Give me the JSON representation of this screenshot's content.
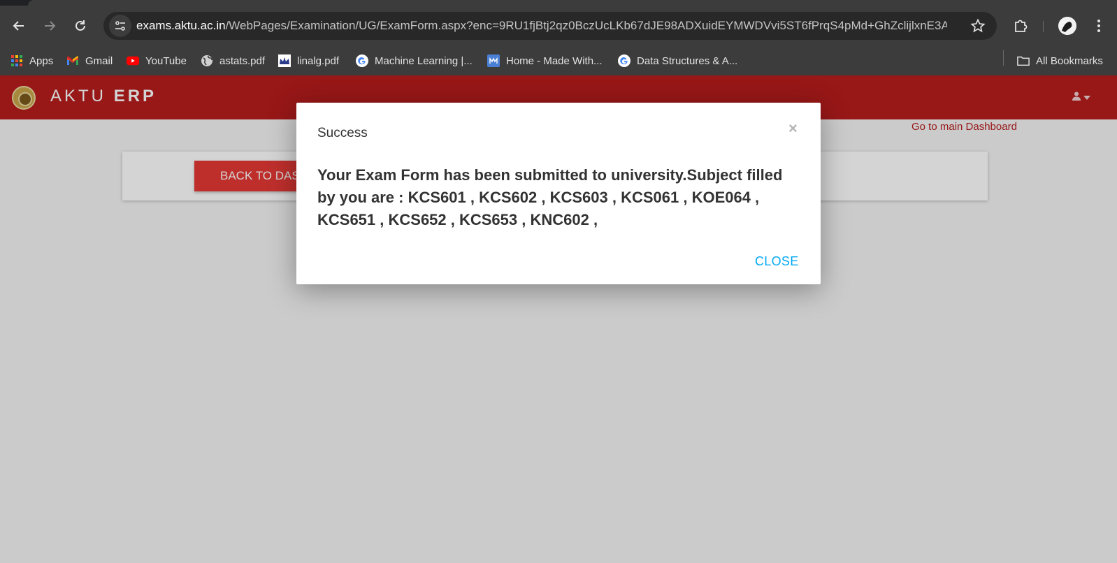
{
  "browser": {
    "url_host": "exams.aktu.ac.in",
    "url_path": "/WebPages/Examination/UG/ExamForm.aspx?enc=9RU1fjBtj2qz0BczUcLKb67dJE98ADXuidEYMWDVvi5ST6fPrqS4pMd+GhZclijlxnE3AX7...",
    "bookmarks": [
      {
        "label": "Apps",
        "icon": "apps-grid-icon"
      },
      {
        "label": "Gmail",
        "icon": "gmail-icon"
      },
      {
        "label": "YouTube",
        "icon": "youtube-icon"
      },
      {
        "label": "astats.pdf",
        "icon": "globe-icon"
      },
      {
        "label": "linalg.pdf",
        "icon": "crown-icon"
      },
      {
        "label": "Machine Learning  |...",
        "icon": "google-icon"
      },
      {
        "label": "Home - Made With...",
        "icon": "madewith-icon"
      },
      {
        "label": "Data Structures & A...",
        "icon": "google-icon"
      }
    ],
    "all_bookmarks_label": "All Bookmarks"
  },
  "header": {
    "brand_light": "AKTU",
    "brand_bold": "ERP",
    "brand_color": "#b71c1c"
  },
  "page": {
    "dashboard_link": "Go to main Dashboard",
    "back_button": "BACK TO DASHBOARD"
  },
  "modal": {
    "title": "Success",
    "close_x": "×",
    "message": "Your Exam Form has been submitted to university.Subject filled by you are : KCS601 , KCS602 , KCS603 , KCS061 , KOE064 , KCS651 , KCS652 , KCS653 , KNC602 ,",
    "close_button": "CLOSE",
    "accent": "#03a9f4"
  }
}
